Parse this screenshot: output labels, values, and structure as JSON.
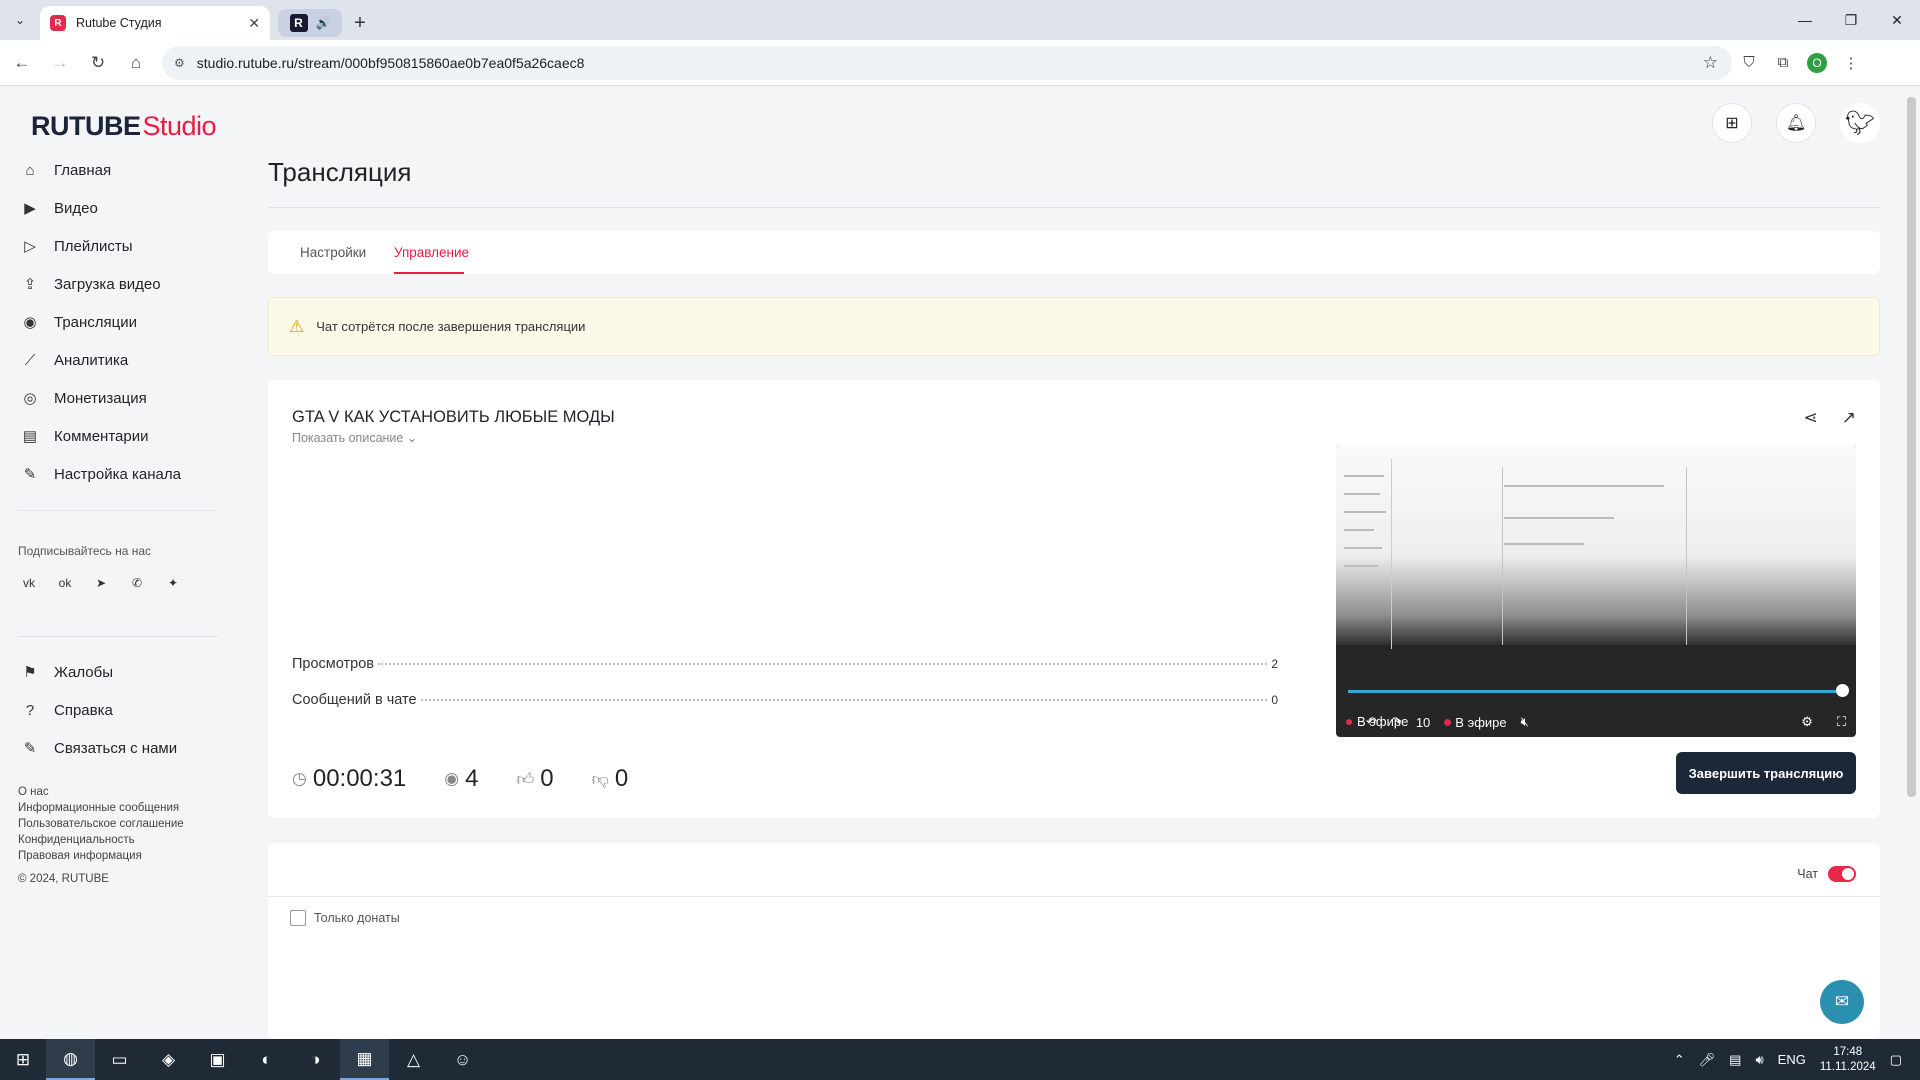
{
  "browser": {
    "tab_title": "Rutube Студия",
    "favicon": "R",
    "tab2_logo": "R",
    "url": "studio.rutube.ru/stream/000bf950815860ae0b7ea0f5a26caec8",
    "profile_letter": "О"
  },
  "brand": {
    "logo_main": "RUTUBE",
    "logo_sub": "Studio",
    "accent": "#ed1a44"
  },
  "sidebar": {
    "items": [
      {
        "label": "Главная",
        "icon": "home-icon",
        "glyph": "⌂"
      },
      {
        "label": "Видео",
        "icon": "video-icon",
        "glyph": "▶"
      },
      {
        "label": "Плейлисты",
        "icon": "playlist-icon",
        "glyph": "▷"
      },
      {
        "label": "Загрузка видео",
        "icon": "upload-icon",
        "glyph": "⇪"
      },
      {
        "label": "Трансляции",
        "icon": "broadcast-icon",
        "glyph": "◉"
      },
      {
        "label": "Аналитика",
        "icon": "analytics-icon",
        "glyph": "⟋"
      },
      {
        "label": "Монетизация",
        "icon": "monetization-icon",
        "glyph": "◎"
      },
      {
        "label": "Комментарии",
        "icon": "comments-icon",
        "glyph": "▤"
      },
      {
        "label": "Настройка канала",
        "icon": "wand-icon",
        "glyph": "✎"
      }
    ],
    "follow_title": "Подписывайтесь на нас",
    "socials": [
      "vk-icon",
      "ok-icon",
      "telegram-icon",
      "viber-icon",
      "more-icon"
    ],
    "bottom_items": [
      {
        "label": "Жалобы",
        "icon": "flag-icon",
        "glyph": "⚑"
      },
      {
        "label": "Справка",
        "icon": "help-icon",
        "glyph": "?"
      },
      {
        "label": "Связаться с нами",
        "icon": "pen-icon",
        "glyph": "✎"
      }
    ],
    "footer_links": [
      "О нас",
      "Информационные сообщения",
      "Пользовательское соглашение",
      "Конфиденциальность",
      "Правовая информация"
    ],
    "copyright": "© 2024, RUTUBE"
  },
  "page": {
    "title": "Трансляция",
    "tabs": [
      {
        "label": "Настройки"
      },
      {
        "label": "Управление"
      }
    ],
    "notice": "Чат сотрётся после завершения трансляции"
  },
  "stream": {
    "title": "GTA V КАК УСТАНОВИТЬ ЛЮБЫЕ МОДЫ",
    "show_description": "Показать описание",
    "stats": [
      {
        "label": "Просмотров",
        "value": "2"
      },
      {
        "label": "Сообщений в чате",
        "value": "0"
      }
    ],
    "duration": "00:00:31",
    "viewers": "4",
    "likes": "0",
    "dislikes": "0",
    "end_button": "Завершить трансляцию"
  },
  "player": {
    "live_label": "В эфире",
    "live_label_2": "В эфире",
    "skip_label": "10",
    "progress": 1.0
  },
  "chat": {
    "toggle_label": "Чат",
    "enabled": true,
    "donate_only_label": "Только донаты"
  },
  "taskbar": {
    "lang": "ENG",
    "time": "17:48",
    "date": "11.11.2024"
  }
}
